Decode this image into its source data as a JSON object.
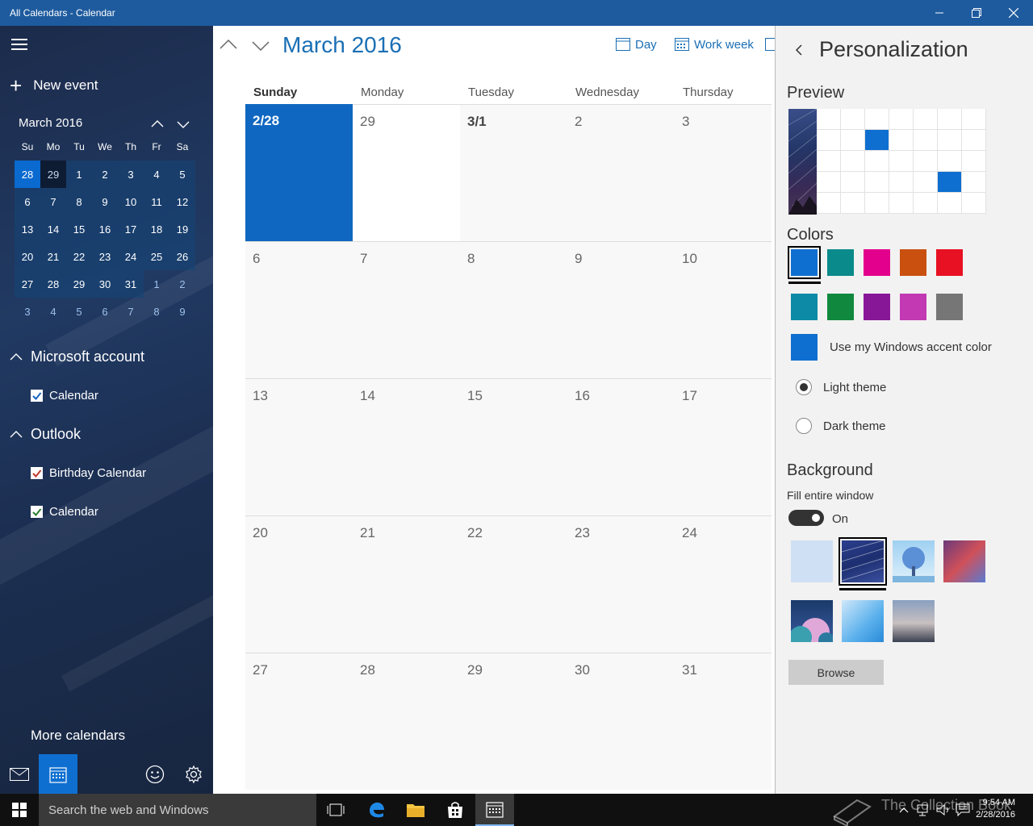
{
  "window": {
    "title": "All Calendars - Calendar"
  },
  "sidebar": {
    "new_event": "New event",
    "mini_month": "March 2016",
    "dow": [
      "Su",
      "Mo",
      "Tu",
      "We",
      "Th",
      "Fr",
      "Sa"
    ],
    "days": [
      "28",
      "29",
      "1",
      "2",
      "3",
      "4",
      "5",
      "6",
      "7",
      "8",
      "9",
      "10",
      "11",
      "12",
      "13",
      "14",
      "15",
      "16",
      "17",
      "18",
      "19",
      "20",
      "21",
      "22",
      "23",
      "24",
      "25",
      "26",
      "27",
      "28",
      "29",
      "30",
      "31",
      "1",
      "2",
      "3",
      "4",
      "5",
      "6",
      "7",
      "8",
      "9"
    ],
    "accounts": [
      {
        "name": "Microsoft account",
        "calendars": [
          {
            "label": "Calendar",
            "color": "#1565c0"
          }
        ]
      },
      {
        "name": "Outlook",
        "calendars": [
          {
            "label": "Birthday Calendar",
            "color": "#c0392b"
          },
          {
            "label": "Calendar",
            "color": "#2e7d32"
          }
        ]
      }
    ],
    "more_calendars": "More calendars"
  },
  "main": {
    "month_title": "March 2016",
    "views": {
      "day": "Day",
      "work_week": "Work week"
    },
    "dow": [
      "Sunday",
      "Monday",
      "Tuesday",
      "Wednesday",
      "Thursday"
    ],
    "weeks": [
      [
        "2/28",
        "29",
        "3/1",
        "2",
        "3"
      ],
      [
        "6",
        "7",
        "8",
        "9",
        "10"
      ],
      [
        "13",
        "14",
        "15",
        "16",
        "17"
      ],
      [
        "20",
        "21",
        "22",
        "23",
        "24"
      ],
      [
        "27",
        "28",
        "29",
        "30",
        "31"
      ]
    ]
  },
  "panel": {
    "title": "Personalization",
    "preview_label": "Preview",
    "colors_label": "Colors",
    "colors_row1": [
      "#0f6fd0",
      "#0a8a8a",
      "#e3008c",
      "#ca5010",
      "#e81123"
    ],
    "colors_row2": [
      "#0d8aa6",
      "#10893e",
      "#881798",
      "#c239b3",
      "#767676"
    ],
    "accent_label": "Use my Windows accent color",
    "light_theme": "Light theme",
    "dark_theme": "Dark theme",
    "background_label": "Background",
    "fill_label": "Fill entire window",
    "toggle_state": "On",
    "browse": "Browse"
  },
  "taskbar": {
    "search_placeholder": "Search the web and Windows",
    "time": "9:54 AM",
    "date": "2/28/2016",
    "watermark": "The Collection Book"
  }
}
